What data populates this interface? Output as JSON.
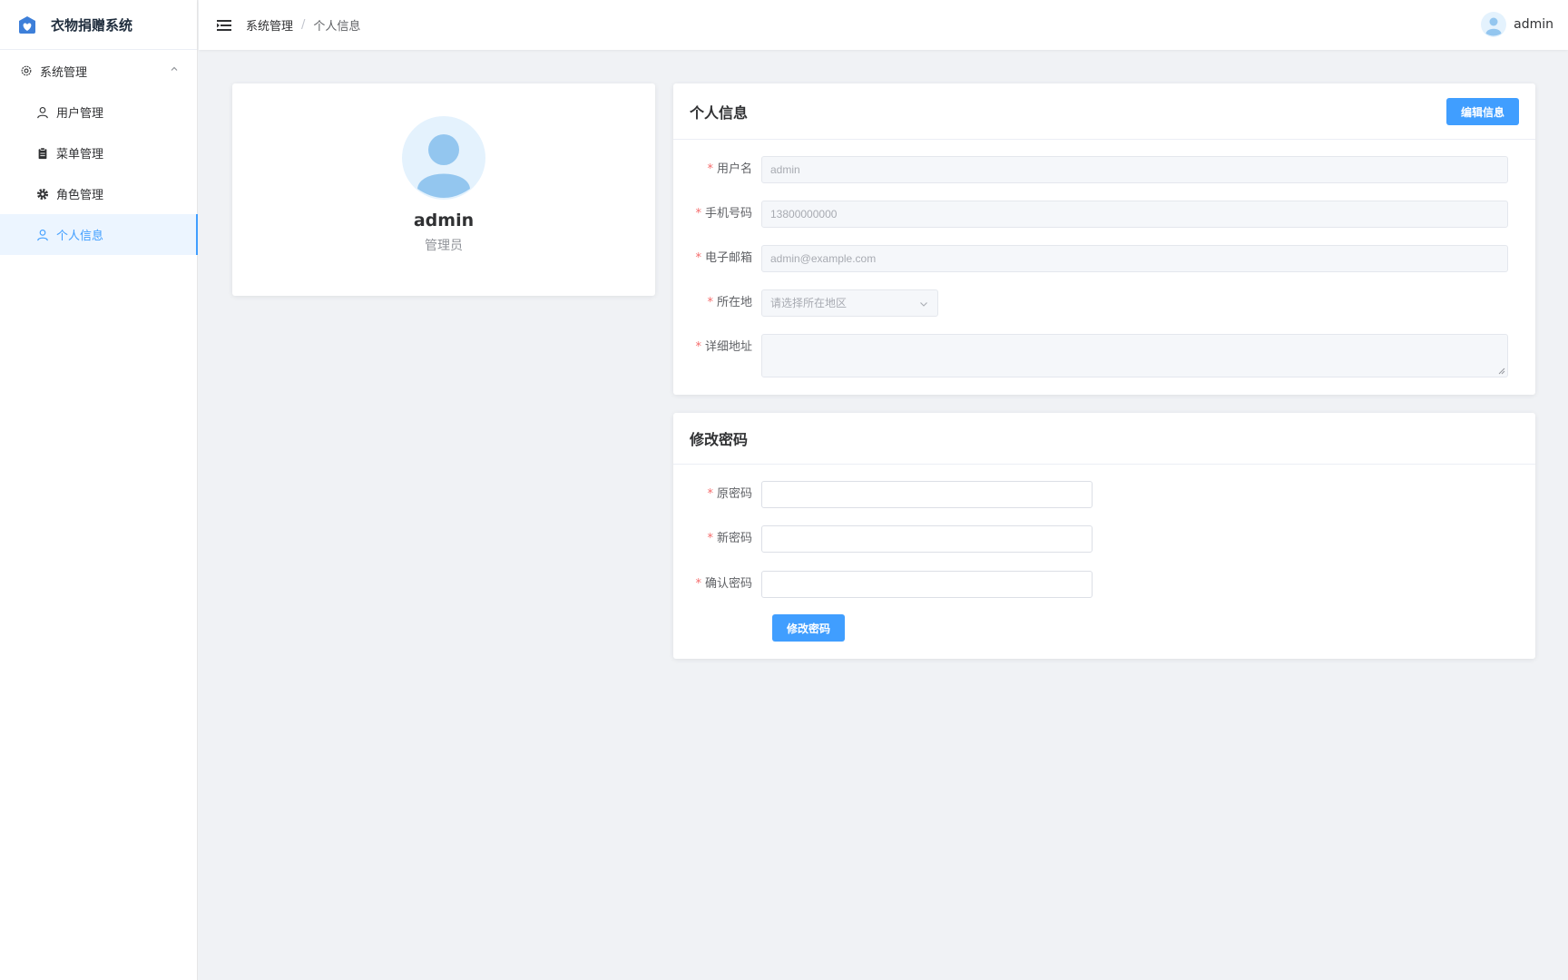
{
  "app": {
    "title": "衣物捐赠系统"
  },
  "sidebar": {
    "group_label": "系统管理",
    "items": [
      {
        "label": "用户管理",
        "icon": "user-icon"
      },
      {
        "label": "菜单管理",
        "icon": "clipboard-icon"
      },
      {
        "label": "角色管理",
        "icon": "gear-solid-icon"
      },
      {
        "label": "个人信息",
        "icon": "user-icon",
        "active": true
      }
    ]
  },
  "header": {
    "breadcrumb": [
      "系统管理",
      "个人信息"
    ],
    "separator": "/",
    "username": "admin"
  },
  "profile": {
    "name": "admin",
    "role": "管理员"
  },
  "info_card": {
    "title": "个人信息",
    "edit_button": "编辑信息",
    "fields": {
      "username": {
        "label": "用户名",
        "value": "admin"
      },
      "phone": {
        "label": "手机号码",
        "value": "13800000000"
      },
      "email": {
        "label": "电子邮箱",
        "value": "admin@example.com"
      },
      "region": {
        "label": "所在地",
        "placeholder": "请选择所在地区"
      },
      "address": {
        "label": "详细地址",
        "value": ""
      }
    }
  },
  "password_card": {
    "title": "修改密码",
    "fields": {
      "old": {
        "label": "原密码"
      },
      "new": {
        "label": "新密码"
      },
      "confirm": {
        "label": "确认密码"
      }
    },
    "submit_button": "修改密码"
  },
  "required_mark": "*",
  "colors": {
    "primary": "#409eff",
    "danger": "#f56c6c",
    "background": "#f0f2f5"
  }
}
